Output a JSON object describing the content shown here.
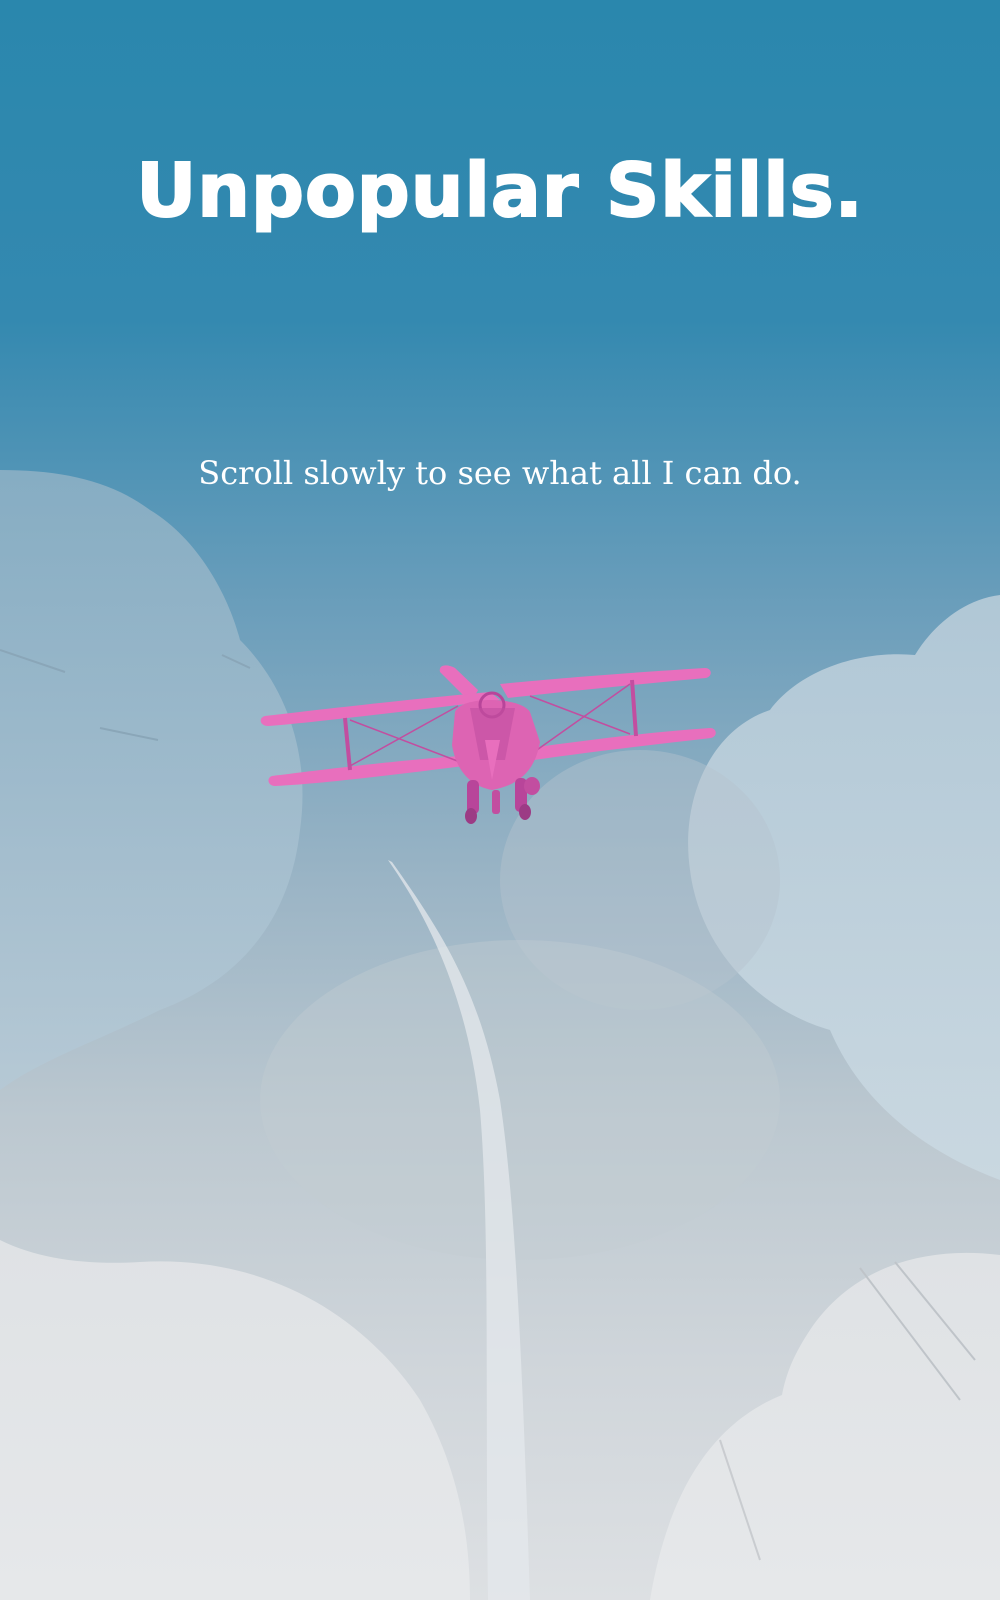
{
  "hero": {
    "title": "Unpopular Skills.",
    "subtitle": "Scroll slowly to see what all I can do."
  },
  "colors": {
    "sky_top": "#2a87ad",
    "sky_bottom": "#dde0e3",
    "cloud": "#bfd3de",
    "plane": "#e86fbd",
    "plane_shadow": "#c24ea0",
    "trail": "#e4e8ec",
    "text": "#ffffff"
  },
  "icons": {
    "plane": "biplane-icon"
  }
}
